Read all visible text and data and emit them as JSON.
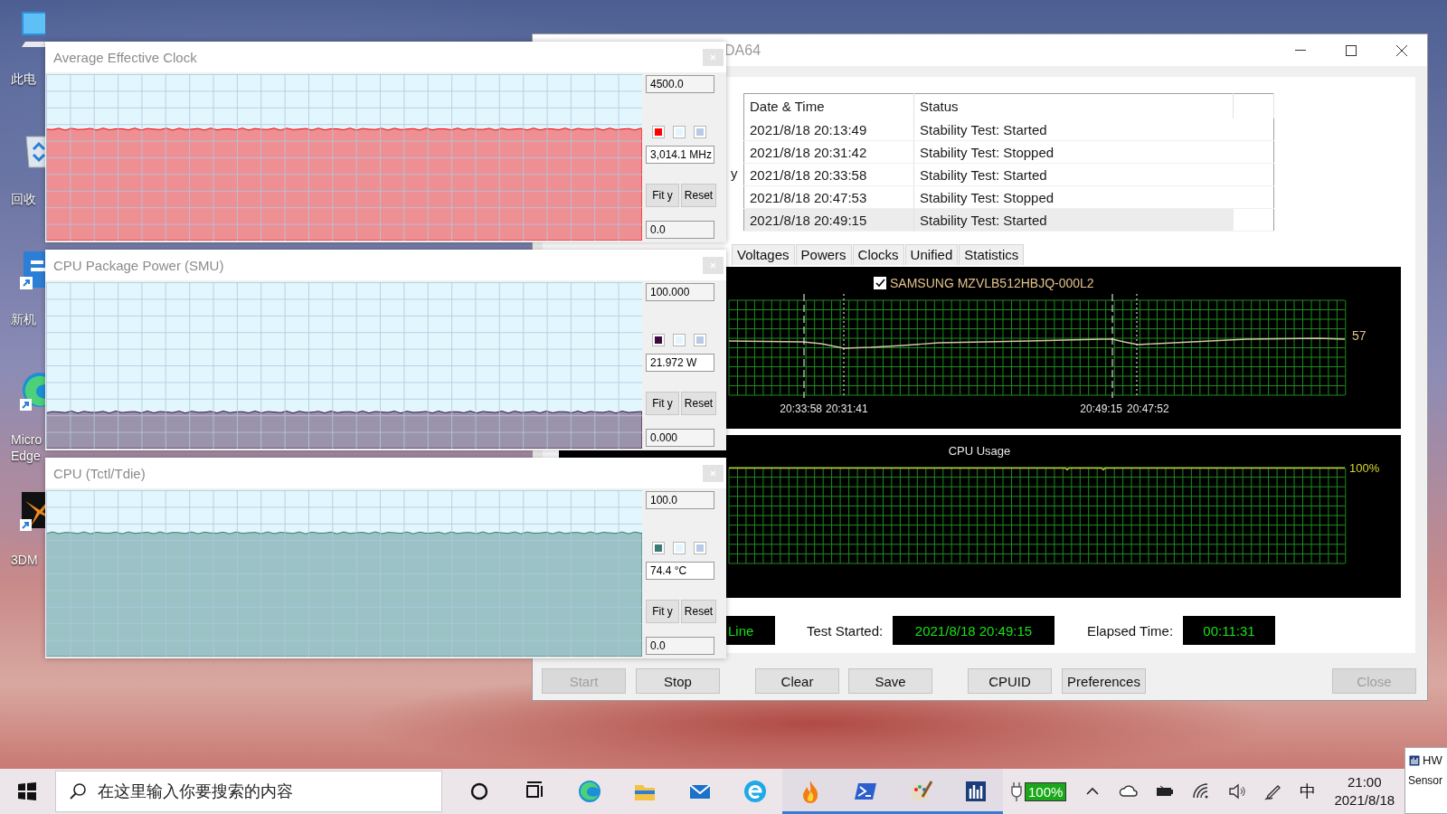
{
  "desktop_icons": [
    {
      "kind": "computer",
      "label": "此电"
    },
    {
      "kind": "recycle-bin",
      "label": "回收"
    },
    {
      "kind": "doc-app",
      "label": "新机"
    },
    {
      "kind": "swirl",
      "label": "Micro Edge"
    },
    {
      "kind": "starburst",
      "label": "3DM"
    }
  ],
  "stability_window": {
    "title": "DA64",
    "fragment": "y",
    "log": {
      "columns": [
        "Date & Time",
        "Status"
      ],
      "rows": [
        {
          "time": "2021/8/18 20:13:49",
          "status": "Stability Test: Started",
          "selected": false
        },
        {
          "time": "2021/8/18 20:31:42",
          "status": "Stability Test: Stopped",
          "selected": false
        },
        {
          "time": "2021/8/18 20:33:58",
          "status": "Stability Test: Started",
          "selected": false
        },
        {
          "time": "2021/8/18 20:47:53",
          "status": "Stability Test: Stopped",
          "selected": false
        },
        {
          "time": "2021/8/18 20:49:15",
          "status": "Stability Test: Started",
          "selected": true
        }
      ]
    },
    "tabs": [
      "Voltages",
      "Powers",
      "Clocks",
      "Unified",
      "Statistics"
    ],
    "sensor_graph": {
      "checked": true,
      "label": "SAMSUNG MZVLB512HBJQ-000L2",
      "reading": "57",
      "markers": [
        {
          "kind": "dashed",
          "label": "20:33:58"
        },
        {
          "kind": "dotted",
          "label": "20:31:41"
        },
        {
          "kind": "dashed",
          "label": "20:49:15"
        },
        {
          "kind": "dotted",
          "label": "20:47:52"
        }
      ]
    },
    "usage_graph": {
      "title": "CPU Usage",
      "reading": "100%"
    },
    "status_row": {
      "fragment": "Line",
      "started_label": "Test Started:",
      "started": "2021/8/18 20:49:15",
      "elapsed_label": "Elapsed Time:",
      "elapsed": "00:11:31"
    },
    "buttons": [
      {
        "label": "Start",
        "disabled": true
      },
      {
        "label": "Stop",
        "disabled": false
      },
      {
        "label": "Clear",
        "disabled": false
      },
      {
        "label": "Save",
        "disabled": false
      },
      {
        "label": "CPUID",
        "disabled": false
      },
      {
        "label": "Preferences",
        "disabled": false
      },
      {
        "label": "Close",
        "disabled": true
      }
    ]
  },
  "sensor_windows": [
    {
      "title": "Average Effective Clock",
      "max": "4500.0",
      "value": "3,014.1 MHz",
      "min": "0.0",
      "color": "#ff0000",
      "buttons": [
        "Fit y",
        "Reset"
      ]
    },
    {
      "title": "CPU Package Power (SMU)",
      "max": "100.000",
      "value": "21.972 W",
      "min": "0.000",
      "color": "#3c0a3c",
      "buttons": [
        "Fit y",
        "Reset"
      ]
    },
    {
      "title": "CPU (Tctl/Tdie)",
      "max": "100.0",
      "value": "74.4 °C",
      "min": "0.0",
      "color": "#3c7a78",
      "buttons": [
        "Fit y",
        "Reset"
      ]
    }
  ],
  "taskbar": {
    "search": {
      "placeholder": "在这里输入你要搜索的内容"
    },
    "apps": [
      {
        "kind": "cortana",
        "running": false
      },
      {
        "kind": "task-view",
        "running": false
      },
      {
        "kind": "swirl",
        "running": false
      },
      {
        "kind": "folder",
        "running": false
      },
      {
        "kind": "envelope",
        "running": false
      },
      {
        "kind": "circle-app",
        "running": false
      },
      {
        "kind": "flame",
        "running": true
      },
      {
        "kind": "terminal",
        "running": true
      },
      {
        "kind": "brush",
        "running": true
      },
      {
        "kind": "meter",
        "running": true
      }
    ],
    "battery_text": "100%",
    "ime": "中",
    "time": "21:00",
    "date": "2021/8/18"
  },
  "popup": {
    "title": "HW",
    "subtitle": "Sensor"
  }
}
